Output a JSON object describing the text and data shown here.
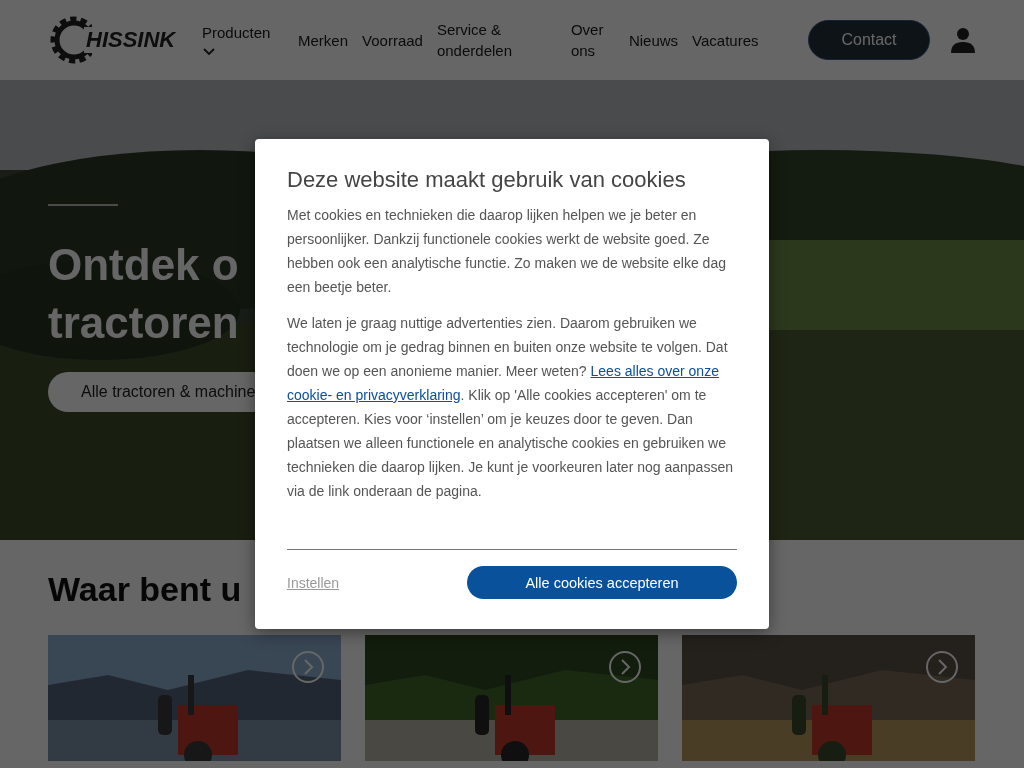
{
  "header": {
    "logo_text": "HISSINK",
    "nav": [
      {
        "label": "Producten",
        "dropdown": true
      },
      {
        "label": "Merken",
        "dropdown": false
      },
      {
        "label": "Voorraad",
        "dropdown": false
      },
      {
        "label": "Service & onderdelen",
        "dropdown": false
      },
      {
        "label": "Over ons",
        "dropdown": false
      },
      {
        "label": "Nieuws",
        "dropdown": false
      },
      {
        "label": "Vacatures",
        "dropdown": false
      }
    ],
    "contact_button": "Contact"
  },
  "hero": {
    "title_lines": [
      "Ontdek o",
      "tractoren"
    ],
    "button": "Alle tractoren & machine"
  },
  "section": {
    "title": "Waar bent u"
  },
  "cookie_dialog": {
    "title": "Deze website maakt gebruik van cookies",
    "paragraphs": [
      "Met cookies en technieken die daarop lijken helpen we je beter en persoonlijker. Dankzij functionele cookies werkt de website goed. Ze hebben ook een analytische functie. Zo maken we de website elke dag een beetje beter."
    ],
    "p2_before": "We laten je graag nuttige advertenties zien. Daarom gebruiken we technologie om je gedrag binnen en buiten onze website te volgen. Dat doen we op een anonieme manier. Meer weten?",
    "p2_link": [
      "Lees alles over onze",
      "cookie- en privacyverklaring"
    ],
    "p2_after": ". Klik op 'Alle cookies accepteren' om te accepteren. Kies voor ‘instellen’ om je keuzes door te geven. Dan plaatsen we alleen functionele en analytische cookies en gebruiken we technieken die daarop lijken. Je kunt je voorkeuren later nog aanpassen via de link onderaan de pagina.",
    "settings_link": "Instellen",
    "accept_button": "Alle cookies accepteren"
  }
}
